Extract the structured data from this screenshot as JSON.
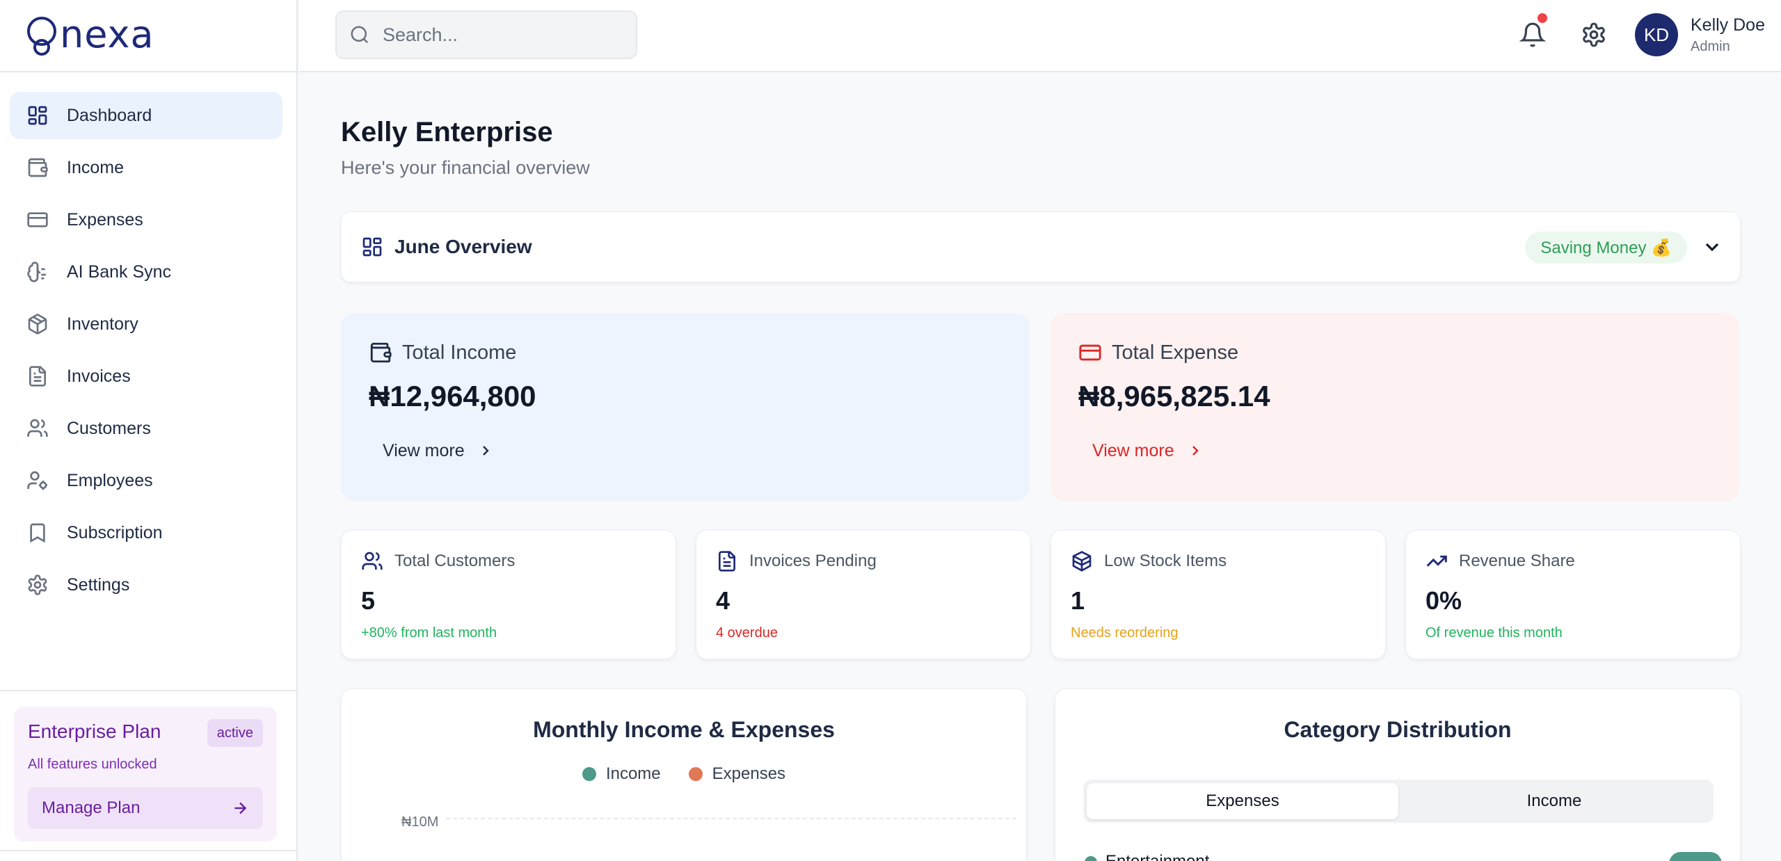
{
  "app": {
    "logo_text": "nexa"
  },
  "sidebar": {
    "items": [
      {
        "label": "Dashboard",
        "icon": "dashboard-icon"
      },
      {
        "label": "Income",
        "icon": "wallet-icon"
      },
      {
        "label": "Expenses",
        "icon": "credit-card-icon"
      },
      {
        "label": "AI Bank Sync",
        "icon": "brain-icon"
      },
      {
        "label": "Inventory",
        "icon": "box-icon"
      },
      {
        "label": "Invoices",
        "icon": "document-icon"
      },
      {
        "label": "Customers",
        "icon": "users-icon"
      },
      {
        "label": "Employees",
        "icon": "user-cog-icon"
      },
      {
        "label": "Subscription",
        "icon": "bookmark-icon"
      },
      {
        "label": "Settings",
        "icon": "gear-icon"
      }
    ],
    "active_item": "Dashboard",
    "plan": {
      "title": "Enterprise Plan",
      "badge": "active",
      "subtitle": "All features unlocked",
      "button_label": "Manage Plan"
    }
  },
  "header": {
    "search_placeholder": "Search...",
    "user": {
      "initials": "KD",
      "name": "Kelly Doe",
      "role": "Admin"
    },
    "notification_unread": true
  },
  "main": {
    "title": "Kelly Enterprise",
    "subtitle": "Here's your financial overview",
    "overview": {
      "title": "June Overview",
      "badge": "Saving Money 💰"
    },
    "totals": {
      "income": {
        "label": "Total Income",
        "value": "₦12,964,800",
        "link": "View more"
      },
      "expense": {
        "label": "Total Expense",
        "value": "₦8,965,825.14",
        "link": "View more"
      }
    },
    "stats": [
      {
        "label": "Total Customers",
        "value": "5",
        "note": "+80% from last month",
        "note_color": "#22b35e"
      },
      {
        "label": "Invoices Pending",
        "value": "4",
        "note": "4 overdue",
        "note_color": "#dc2626"
      },
      {
        "label": "Low Stock Items",
        "value": "1",
        "note": "Needs reordering",
        "note_color": "#e5a21a"
      },
      {
        "label": "Revenue Share",
        "value": "0%",
        "note": "Of revenue this month",
        "note_color": "#22b35e"
      }
    ],
    "income_expense_chart": {
      "title": "Monthly Income & Expenses",
      "legend": [
        {
          "name": "Income",
          "color": "#4d9a8a"
        },
        {
          "name": "Expenses",
          "color": "#e07856"
        }
      ],
      "y_tick_top": "₦10M"
    },
    "category_distribution": {
      "title": "Category Distribution",
      "tabs": [
        "Expenses",
        "Income"
      ],
      "active_tab": "Expenses",
      "first_category": "Entertainment"
    }
  }
}
